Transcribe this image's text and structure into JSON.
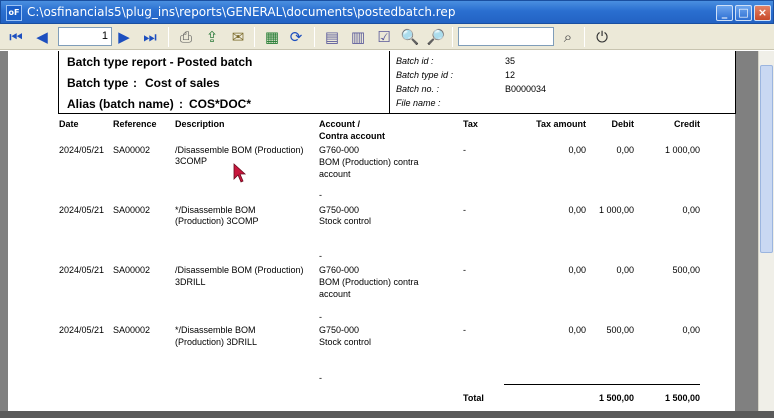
{
  "window": {
    "title": "C:\\osfinancials5\\plug_ins\\reports\\GENERAL\\documents\\postedbatch.rep",
    "icon_text": "oF"
  },
  "toolbar": {
    "page_number": "1",
    "icons": [
      "first-page-icon",
      "prev-page-icon",
      "next-page-icon",
      "last-page-icon",
      "print-icon",
      "export-icon",
      "email-icon",
      "excel-icon",
      "refresh-icon",
      "page-layout-icon",
      "zoom-fit-icon",
      "zoom-width-icon",
      "zoom-out-icon",
      "zoom-in-icon",
      "search-icon",
      "close-icon"
    ]
  },
  "report": {
    "title": "Batch type report - Posted batch",
    "batch_type_label": "Batch type",
    "batch_type_value": "Cost of sales",
    "alias_label": "Alias (batch name)",
    "alias_value": "COS*DOC*",
    "batch_id_label": "Batch id :",
    "batch_id_value": "35",
    "batch_type_id_label": "Batch type id :",
    "batch_type_id_value": "12",
    "batch_no_label": "Batch no. :",
    "batch_no_value": "B0000034",
    "file_name_label": "File name :",
    "columns": {
      "date": "Date",
      "reference": "Reference",
      "description": "Description",
      "account": "Account /",
      "contra": "Contra account",
      "tax": "Tax",
      "tax_amount": "Tax amount",
      "debit": "Debit",
      "credit": "Credit"
    },
    "rows": [
      {
        "date": "2024/05/21",
        "ref": "SA00002",
        "desc1": "/Disassemble BOM (Production)",
        "desc2": "3COMP",
        "acc": "G760-000",
        "contra1": " BOM (Production) contra",
        "contra2": "account",
        "tax": "-",
        "tax_amount": "0,00",
        "debit": "0,00",
        "credit": "1 000,00",
        "dash": "-"
      },
      {
        "date": "2024/05/21",
        "ref": "SA00002",
        "desc1": "*/Disassemble BOM",
        "desc2": "(Production) 3COMP",
        "acc": "G750-000",
        "contra1": "Stock control",
        "contra2": "",
        "tax": "-",
        "tax_amount": "0,00",
        "debit": "1 000,00",
        "credit": "0,00",
        "dash": "-"
      },
      {
        "date": "2024/05/21",
        "ref": "SA00002",
        "desc1": "/Disassemble BOM (Production)",
        "desc2": "3DRILL",
        "acc": "G760-000",
        "contra1": " BOM (Production) contra",
        "contra2": "account",
        "tax": "-",
        "tax_amount": "0,00",
        "debit": "0,00",
        "credit": "500,00",
        "dash": "-"
      },
      {
        "date": "2024/05/21",
        "ref": "SA00002",
        "desc1": "*/Disassemble BOM",
        "desc2": "(Production) 3DRILL",
        "acc": "G750-000",
        "contra1": "Stock control",
        "contra2": "",
        "tax": "-",
        "tax_amount": "0,00",
        "debit": "500,00",
        "credit": "0,00",
        "dash": "-"
      }
    ],
    "total_label": "Total",
    "total_debit": "1 500,00",
    "total_credit": "1 500,00"
  }
}
